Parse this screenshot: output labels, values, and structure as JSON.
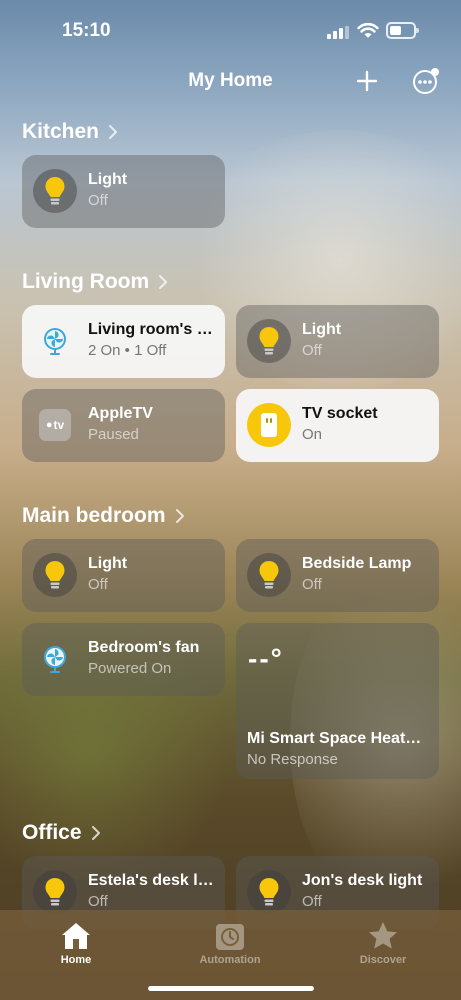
{
  "status_bar": {
    "time": "15:10"
  },
  "nav": {
    "title": "My Home"
  },
  "rooms": {
    "kitchen": {
      "title": "Kitchen",
      "devices": [
        {
          "name": "Light",
          "state": "Off",
          "icon": "bulb-icon"
        }
      ]
    },
    "living_room": {
      "title": "Living Room",
      "devices": [
        {
          "name": "Living room's fan",
          "state": "2 On • 1 Off",
          "icon": "fan-icon"
        },
        {
          "name": "Light",
          "state": "Off",
          "icon": "bulb-icon"
        },
        {
          "name": "AppleTV",
          "state": "Paused",
          "icon": "appletv-icon",
          "icon_text": "tv"
        },
        {
          "name": "TV socket",
          "state": "On",
          "icon": "socket-icon"
        }
      ]
    },
    "main_bedroom": {
      "title": "Main bedroom",
      "devices": [
        {
          "name": "Light",
          "state": "Off",
          "icon": "bulb-icon"
        },
        {
          "name": "Bedside Lamp",
          "state": "Off",
          "icon": "bulb-icon"
        },
        {
          "name": "Bedroom's fan",
          "state": "Powered On",
          "icon": "fan-icon"
        },
        {
          "name": "Mi Smart Space Heater S",
          "state": "No Response",
          "icon": "heater-icon",
          "glyph": "--°"
        }
      ]
    },
    "office": {
      "title": "Office",
      "devices": [
        {
          "name": "Estela's desk light",
          "state": "Off",
          "icon": "bulb-icon"
        },
        {
          "name": "Jon's desk light",
          "state": "Off",
          "icon": "bulb-icon"
        }
      ]
    }
  },
  "tabs": [
    {
      "label": "Home",
      "icon": "house-icon",
      "active": true
    },
    {
      "label": "Automation",
      "icon": "clock-icon",
      "active": false
    },
    {
      "label": "Discover",
      "icon": "star-icon",
      "active": false
    }
  ],
  "colors": {
    "accent_yellow": "#f6c70a",
    "fan_blue": "#3ea8d6"
  }
}
